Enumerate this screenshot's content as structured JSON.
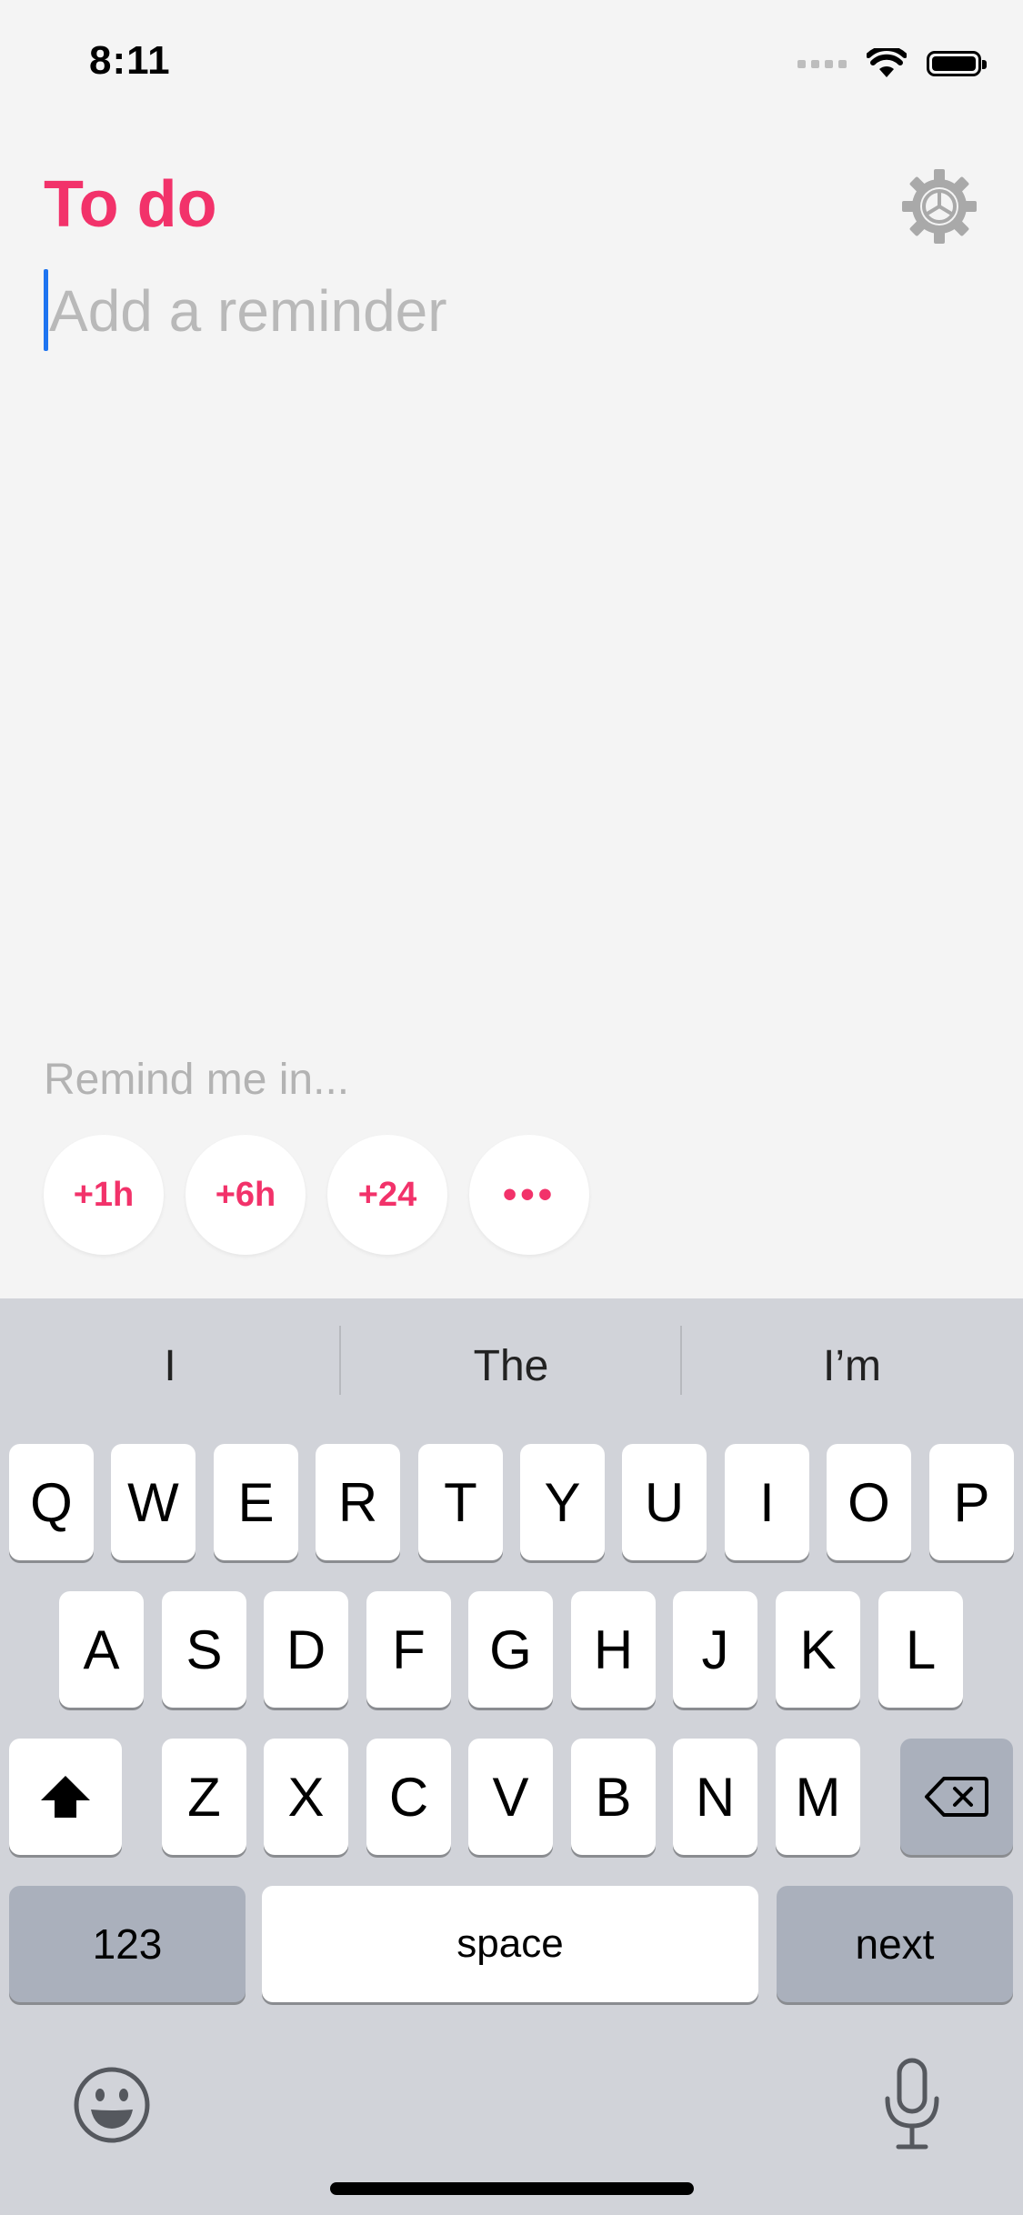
{
  "status_bar": {
    "time": "8:11",
    "signal_icon": "cellular-signal-icon",
    "wifi_icon": "wifi-icon",
    "battery_icon": "battery-icon"
  },
  "header": {
    "title": "To do",
    "settings_icon": "gear-icon"
  },
  "reminder": {
    "value": "",
    "placeholder": "Add a reminder"
  },
  "remind": {
    "label": "Remind me in...",
    "options": [
      "+1h",
      "+6h",
      "+24",
      "•••"
    ]
  },
  "keyboard": {
    "suggestions": [
      "I",
      "The",
      "I’m"
    ],
    "row1": [
      "Q",
      "W",
      "E",
      "R",
      "T",
      "Y",
      "U",
      "I",
      "O",
      "P"
    ],
    "row2": [
      "A",
      "S",
      "D",
      "F",
      "G",
      "H",
      "J",
      "K",
      "L"
    ],
    "row3": [
      "Z",
      "X",
      "C",
      "V",
      "B",
      "N",
      "M"
    ],
    "numbers_label": "123",
    "space_label": "space",
    "next_label": "next",
    "shift_icon": "shift-icon",
    "delete_icon": "delete-icon",
    "emoji_icon": "emoji-icon",
    "mic_icon": "microphone-icon"
  },
  "colors": {
    "accent": "#f2326a",
    "cursor": "#1e74f0",
    "background": "#f4f4f4",
    "keyboard_bg": "#d1d3d9"
  }
}
